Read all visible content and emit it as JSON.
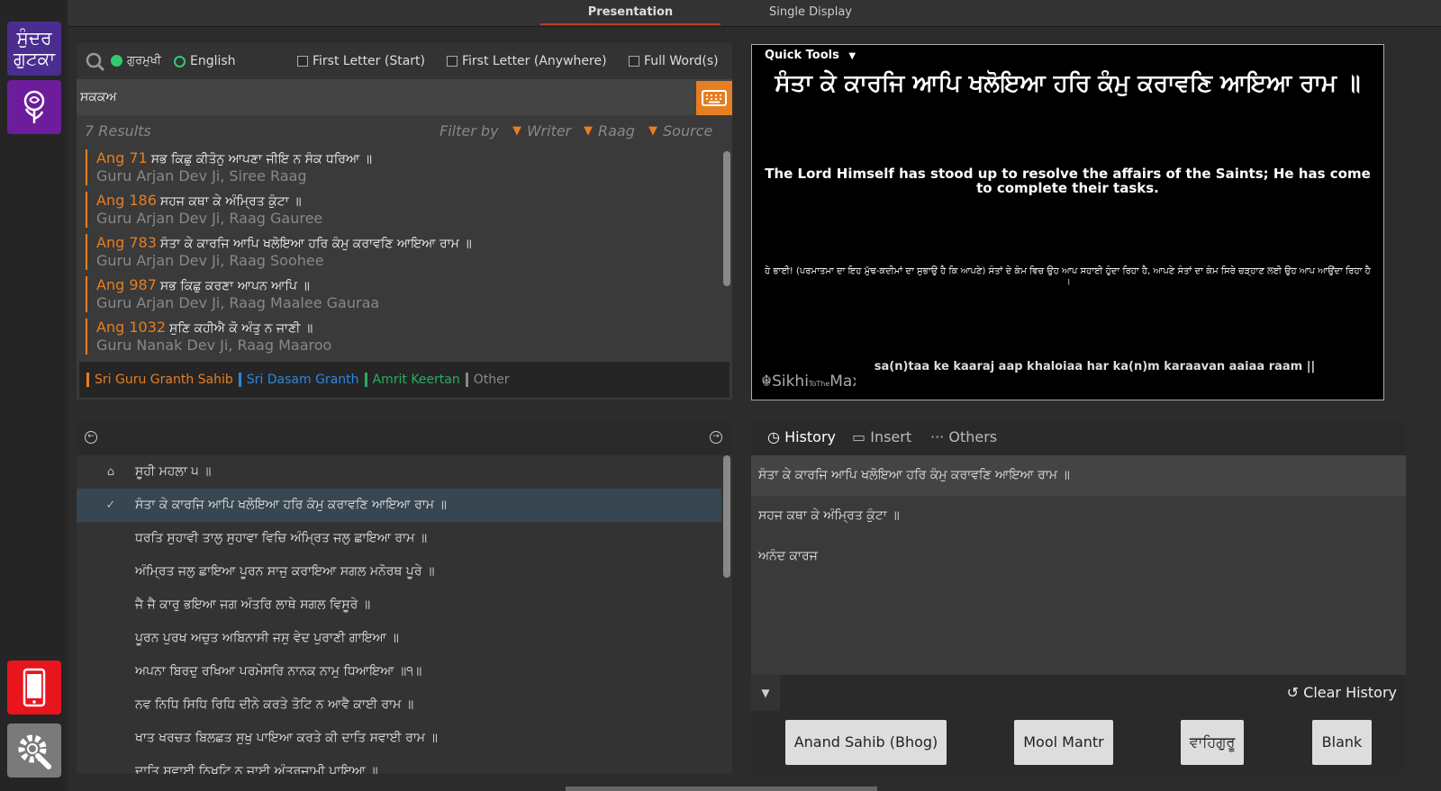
{
  "sidebar": {
    "gutka_label_1": "ਸੁੰਦਰ",
    "gutka_label_2": "ਗੁਟਕਾ"
  },
  "tabs": {
    "presentation": "Presentation",
    "single": "Single Display"
  },
  "search": {
    "gurmukhi_label": "ਗੁਰਮੁਖੀ",
    "english_label": "English",
    "opt1": "First Letter (Start)",
    "opt2": "First Letter (Anywhere)",
    "opt3": "Full Word(s)",
    "query": "ਸਕਕਅ",
    "results_count": "7 Results",
    "filter_by": "Filter by",
    "f_writer": "Writer",
    "f_raag": "Raag",
    "f_source": "Source"
  },
  "results": [
    {
      "ang": "Ang 71",
      "text": "ਸਭ ਕਿਛੁ ਕੀਤੋਨੁ ਆਪਣਾ ਜੀਇ ਨ ਸੰਕ ਧਰਿਆ ॥",
      "meta": "Guru Arjan Dev Ji, Siree Raag"
    },
    {
      "ang": "Ang 186",
      "text": "ਸਹਜ ਕਥਾ ਕੇ ਅੰਮ੍ਰਿਤ ਕੁੰਟਾ ॥",
      "meta": "Guru Arjan Dev Ji, Raag Gauree"
    },
    {
      "ang": "Ang 783",
      "text": "ਸੰਤਾ ਕੇ ਕਾਰਜਿ ਆਪਿ ਖਲੋਇਆ ਹਰਿ ਕੰਮੁ ਕਰਾਵਣਿ ਆਇਆ ਰਾਮ ॥",
      "meta": "Guru Arjan Dev Ji, Raag Soohee"
    },
    {
      "ang": "Ang 987",
      "text": "ਸਭ ਕਿਛੁ ਕਰਣਾ ਆਪਨ ਆਪਿ ॥",
      "meta": "Guru Arjan Dev Ji, Raag Maalee Gauraa"
    },
    {
      "ang": "Ang 1032",
      "text": "ਸੁਣਿ ਕਹੀਐ ਕੋ ਅੰਤੁ ਨ ਜਾਣੀ ॥",
      "meta": "Guru Nanak Dev Ji, Raag Maaroo"
    }
  ],
  "sources": {
    "sggs": "Sri Guru Granth Sahib",
    "dasam": "Sri Dasam Granth",
    "amrit": "Amrit Keertan",
    "other": "Other"
  },
  "bani_lines": [
    "ਸੂਹੀ ਮਹਲਾ ੫ ॥",
    "ਸੰਤਾ ਕੇ ਕਾਰਜਿ ਆਪਿ ਖਲੋਇਆ ਹਰਿ ਕੰਮੁ ਕਰਾਵਣਿ ਆਇਆ ਰਾਮ ॥",
    "ਧਰਤਿ ਸੁਹਾਵੀ ਤਾਲੁ ਸੁਹਾਵਾ ਵਿਚਿ ਅੰਮ੍ਰਿਤ ਜਲੁ ਛਾਇਆ ਰਾਮ ॥",
    "ਅੰਮ੍ਰਿਤ ਜਲੁ ਛਾਇਆ ਪੂਰਨ ਸਾਜੁ ਕਰਾਇਆ ਸਗਲ ਮਨੋਰਥ ਪੂਰੇ ॥",
    "ਜੈ ਜੈ ਕਾਰੁ ਭਇਆ ਜਗ ਅੰਤਰਿ ਲਾਥੇ ਸਗਲ ਵਿਸੂਰੇ ॥",
    "ਪੂਰਨ ਪੁਰਖ ਅਚੁਤ ਅਬਿਨਾਸੀ ਜਸੁ ਵੇਦ ਪੁਰਾਣੀ ਗਾਇਆ ॥",
    "ਅਪਨਾ ਬਿਰਦੁ ਰਖਿਆ ਪਰਮੇਸਰਿ ਨਾਨਕ ਨਾਮੁ ਧਿਆਇਆ ॥੧॥",
    "ਨਵ ਨਿਧਿ ਸਿਧਿ ਰਿਧਿ ਦੀਨੇ ਕਰਤੇ ਤੋਟਿ ਨ ਆਵੈ ਕਾਈ ਰਾਮ ॥",
    "ਖਾਤ ਖਰਚਤ ਬਿਲਛਤ ਸੁਖੁ ਪਾਇਆ ਕਰਤੇ ਕੀ ਦਾਤਿ ਸਵਾਈ ਰਾਮ ॥",
    "ਦਾਤਿ ਸਵਾਈ ਨਿਖੁਟਿ ਨ ਜਾਈ ਅੰਤਰਜਾਮੀ ਪਾਇਆ ॥"
  ],
  "display": {
    "quick_tools": "Quick Tools",
    "gurmukhi": "ਸੰਤਾ ਕੇ ਕਾਰਜਿ ਆਪਿ ਖਲੋਇਆ ਹਰਿ ਕੰਮੁ ਕਰਾਵਣਿ ਆਇਆ ਰਾਮ ॥",
    "english": "The Lord Himself has stood up to resolve the affairs of the Saints; He has come to complete their tasks.",
    "punjabi": "ਹੇ ਭਾਈ! (ਪਰਮਾਤਮਾ ਦਾ ਇਹ ਮੁੱਢ-ਕਦੀਮਾਂ ਦਾ ਸੁਭਾਉ ਹੈ ਕਿ ਆਪਣੇ) ਸੰਤਾਂ ਦੇ ਕੰਮ ਵਿਚ ਉਹ ਆਪ ਸਹਾਈ ਹੁੰਦਾ ਰਿਹਾ ਹੈ, ਆਪਣੇ ਸੰਤਾਂ ਦਾ ਕੰਮ ਸਿਰੇ ਚੜ੍ਹਾਣ ਲਈ ਉਹ ਆਪ ਆਉਂਦਾ ਰਿਹਾ ਹੈ ।",
    "translit": "sa(n)taa ke kaaraj aap khaloiaa har ka(n)m karaavan aaiaa raam ||",
    "logo": "SikhiToTheMax"
  },
  "history": {
    "tab_history": "History",
    "tab_insert": "Insert",
    "tab_others": "Others",
    "items": [
      "ਸੰਤਾ ਕੇ ਕਾਰਜਿ ਆਪਿ ਖਲੋਇਆ ਹਰਿ ਕੰਮੁ ਕਰਾਵਣਿ ਆਇਆ ਰਾਮ ॥",
      "ਸਹਜ ਕਥਾ ਕੇ ਅੰਮ੍ਰਿਤ ਕੁੰਟਾ ॥",
      "ਅਨੰਦ ਕਾਰਜ"
    ],
    "clear": "Clear History"
  },
  "quick_buttons": [
    "Anand Sahib (Bhog)",
    "Mool Mantr",
    "ਵਾਹਿਗੁਰੂ",
    "Blank"
  ],
  "colors": {
    "accent": "#e67e22",
    "sggs": "#e67e22",
    "dasam": "#2e86de",
    "amrit": "#27ae60",
    "other": "#888888"
  }
}
